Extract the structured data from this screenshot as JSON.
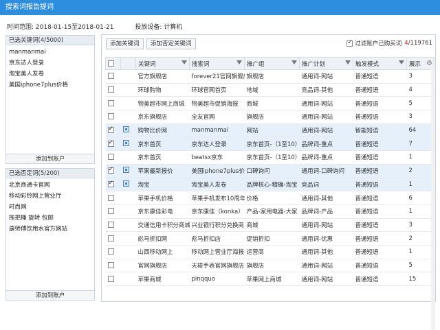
{
  "window": {
    "title": "搜索词报告提词"
  },
  "meta": {
    "time_range": "时间范围: 2018-01-15至2018-01-21",
    "device": "投放设备: 计算机"
  },
  "selected_keywords": {
    "header": "已选关键词(4/5000)",
    "items": [
      "manmanmai",
      "京东达人登录",
      "淘宝美人发卷",
      "美国iphone7plus价格"
    ],
    "add_button": "添加到账户"
  },
  "selected_negatives": {
    "header": "已选否定词(5/200)",
    "items": [
      "北京商通卡官网",
      "移动彩铃网上营业厅",
      "时尚网",
      "拖把桶 旋转 包邮",
      "康师傅饮用水官方网站"
    ],
    "add_button": "添加到账户"
  },
  "toolbar": {
    "add_keyword": "添加关键词",
    "add_negative": "添加否定关键词",
    "filter_label": "过滤账户已购买词",
    "count_current": "4",
    "count_total": "/119761"
  },
  "table": {
    "headers": [
      "关键词",
      "搜索词",
      "推广组",
      "推广计划",
      "触发模式",
      "展示"
    ],
    "rows": [
      {
        "checked": false,
        "selected": false,
        "icon": false,
        "keyword": "官方旗舰店",
        "search": "forever21官网旗舰店",
        "group": "旗舰店",
        "plan": "通用词-网站",
        "mode": "普通短语",
        "impr": "3"
      },
      {
        "checked": false,
        "selected": false,
        "icon": false,
        "keyword": "环球购物",
        "search": "环球官网首页",
        "group": "地域",
        "plan": "竞品词-其他",
        "mode": "普通短语",
        "impr": "4"
      },
      {
        "checked": false,
        "selected": false,
        "icon": false,
        "keyword": "物美超市网上商城",
        "search": "物美超市促销海报",
        "group": "商城",
        "plan": "通用词-网站",
        "mode": "普通短语",
        "impr": "5"
      },
      {
        "checked": false,
        "selected": false,
        "icon": false,
        "keyword": "京东旗舰店",
        "search": "全友官网",
        "group": "旗舰店",
        "plan": "通用词-网站",
        "mode": "普通短语",
        "impr": "3"
      },
      {
        "checked": true,
        "selected": true,
        "icon": true,
        "keyword": "购物比价网",
        "search": "manmanmai",
        "group": "网站",
        "plan": "通用词-网站",
        "mode": "智能短语",
        "impr": "64"
      },
      {
        "checked": true,
        "selected": true,
        "icon": true,
        "keyword": "京东首页",
        "search": "京东达人登录",
        "group": "京东首页-（1至10）",
        "plan": "品牌词-重点",
        "mode": "普通短语",
        "impr": "7"
      },
      {
        "checked": false,
        "selected": false,
        "icon": false,
        "keyword": "京东首页",
        "search": "beatsx京东",
        "group": "京东首页-（1至10）",
        "plan": "品牌词-重点",
        "mode": "普通短语",
        "impr": "1"
      },
      {
        "checked": true,
        "selected": true,
        "icon": true,
        "keyword": "苹果最新报价",
        "search": "美国iphone7plus价",
        "group": "口碑询问",
        "plan": "通用词-口碑询问",
        "mode": "普通短语",
        "impr": "2"
      },
      {
        "checked": true,
        "selected": true,
        "icon": true,
        "keyword": "淘宝",
        "search": "淘宝美人发卷",
        "group": "品牌核心-精确-淘宝",
        "plan": "竞品词",
        "mode": "普通短语",
        "impr": "1"
      },
      {
        "checked": false,
        "selected": false,
        "icon": false,
        "keyword": "苹果手机价格",
        "search": "苹果手机发布10周年",
        "group": "价格",
        "plan": "通用词-其他",
        "mode": "普通短语",
        "impr": "6"
      },
      {
        "checked": false,
        "selected": false,
        "icon": false,
        "keyword": "京东康佳彩电",
        "search": "京东康佳（konka）",
        "group": "产品-家用电器-大家",
        "plan": "品牌词-产品",
        "mode": "普通短语",
        "impr": "1"
      },
      {
        "checked": false,
        "selected": false,
        "icon": false,
        "keyword": "交通信用卡积分商城",
        "search": "兴业银行积分兑换商",
        "group": "商城",
        "plan": "通用词-网站",
        "mode": "普通短语",
        "impr": "3"
      },
      {
        "checked": false,
        "selected": false,
        "icon": false,
        "keyword": "彪马折扣网",
        "search": "彪马折扣店",
        "group": "促销折扣",
        "plan": "通用词-优惠",
        "mode": "普通短语",
        "impr": "2"
      },
      {
        "checked": false,
        "selected": false,
        "icon": false,
        "keyword": "山西移动网上",
        "search": "移动网上营业厅海报",
        "group": "运营商",
        "plan": "通用词-其他",
        "mode": "普通短语",
        "impr": "1"
      },
      {
        "checked": false,
        "selected": false,
        "icon": false,
        "keyword": "官网旗舰店",
        "search": "天梭手表官网旗舰店",
        "group": "旗舰店",
        "plan": "通用词-网站",
        "mode": "普通短语",
        "impr": "5"
      },
      {
        "checked": false,
        "selected": false,
        "icon": false,
        "keyword": "苹果商城",
        "search": "pinqquo",
        "group": "苹果网上商城",
        "plan": "通用词-网站",
        "mode": "普通短语",
        "impr": "15"
      }
    ]
  }
}
